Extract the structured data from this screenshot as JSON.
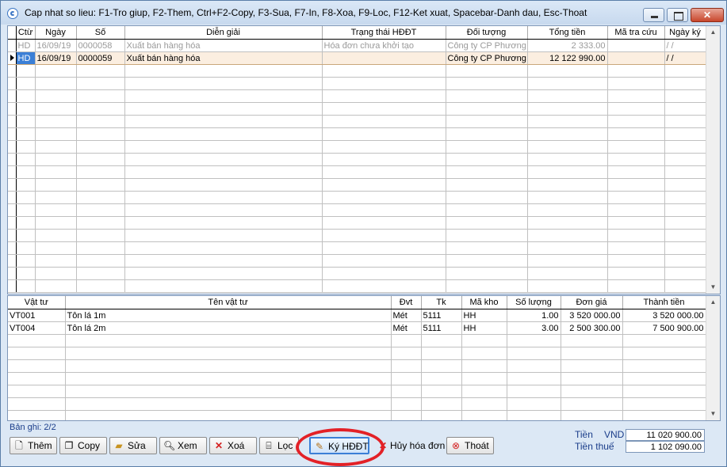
{
  "window": {
    "title": "Cap nhat so lieu: F1-Tro giup, F2-Them, Ctrl+F2-Copy, F3-Sua, F7-In, F8-Xoa, F9-Loc, F12-Ket xuat, Spacebar-Danh dau, Esc-Thoat",
    "min_glyph": "",
    "max_glyph": "",
    "close_glyph": "✕"
  },
  "top_table": {
    "columns": [
      "Ctừ",
      "Ngày",
      "Số",
      "Diễn giải",
      "Trạng thái HĐĐT",
      "Đối tượng",
      "Tổng tiền",
      "Mã tra cứu",
      "Ngày ký"
    ],
    "rows": [
      {
        "ctu": "HD",
        "ngay": "16/09/19",
        "so": "0000058",
        "dien_giai": "Xuất bán hàng hóa",
        "trang_thai": "Hóa đơn chưa khởi tạo",
        "doi_tuong": "Công ty CP Phương Đ",
        "tong_tien": "2 333.00",
        "ma_tra_cuu": "",
        "ngay_ky": "/ /"
      },
      {
        "ctu": "HD",
        "ngay": "16/09/19",
        "so": "0000059",
        "dien_giai": "Xuất bán hàng hóa",
        "trang_thai": "",
        "doi_tuong": "Công ty CP Phương Đ",
        "tong_tien": "12 122 990.00",
        "ma_tra_cuu": "",
        "ngay_ky": "/ /"
      }
    ]
  },
  "bottom_table": {
    "columns": [
      "Vật tư",
      "Tên vật tư",
      "Đvt",
      "Tk",
      "Mã kho",
      "Số lượng",
      "Đơn giá",
      "Thành tiền"
    ],
    "rows": [
      {
        "vat_tu": "VT001",
        "ten": "Tôn lá 1m",
        "dvt": "Mét",
        "tk": "5111",
        "kho": "HH",
        "so_luong": "1.00",
        "don_gia": "3 520 000.00",
        "thanh_tien": "3 520 000.00"
      },
      {
        "vat_tu": "VT004",
        "ten": "Tôn lá 2m",
        "dvt": "Mét",
        "tk": "5111",
        "kho": "HH",
        "so_luong": "3.00",
        "don_gia": "2 500 300.00",
        "thanh_tien": "7 500 900.00"
      }
    ]
  },
  "status": {
    "records": "Bản ghi: 2/2"
  },
  "buttons": {
    "them": "Thêm",
    "copy": "Copy",
    "sua": "Sửa",
    "xem": "Xem",
    "xoa": "Xoá",
    "loc": "Lọc",
    "ky": "Ký HĐĐT",
    "huy": "Hủy hóa đơn",
    "thoat": "Thoát"
  },
  "totals": {
    "tien_label": "Tiền",
    "currency": "VND",
    "tien_value": "11 020 900.00",
    "thue_label": "Tiền thuế",
    "thue_value": "1 102 090.00"
  },
  "colors": {
    "selection": "#3b7fd6",
    "highlight_circle": "#e32127"
  }
}
